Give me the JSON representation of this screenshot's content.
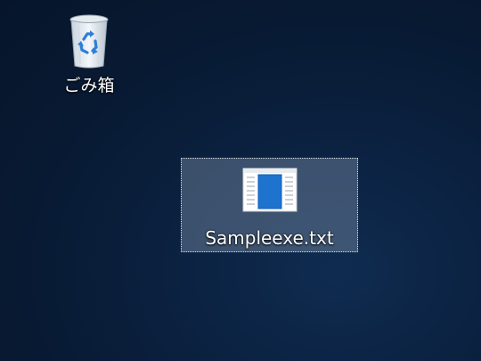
{
  "desktop": {
    "icons": [
      {
        "label": "ごみ箱",
        "icon": "recycle-bin-icon",
        "selected": false
      },
      {
        "label": "Sampleexe.txt",
        "icon": "application-window-icon",
        "selected": true
      }
    ]
  },
  "colors": {
    "background": "#0b2140",
    "selection": "#788ca5",
    "bin_accent": "#2d7fd6",
    "file_accent": "#1e73cf"
  }
}
